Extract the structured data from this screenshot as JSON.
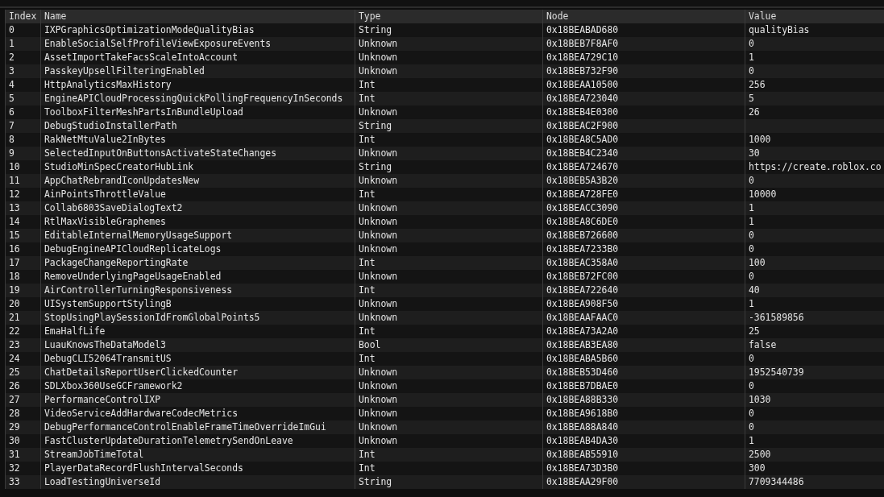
{
  "table": {
    "columns": [
      "Index",
      "Name",
      "Type",
      "Node",
      "Value"
    ],
    "rows": [
      {
        "index": "0",
        "name": "IXPGraphicsOptimizationModeQualityBias",
        "type": "String",
        "node": "0x18BEABAD680",
        "value": "qualityBias"
      },
      {
        "index": "1",
        "name": "EnableSocialSelfProfileViewExposureEvents",
        "type": "Unknown",
        "node": "0x18BEB7F8AF0",
        "value": "0"
      },
      {
        "index": "2",
        "name": "AssetImportTakeFacsScaleIntoAccount",
        "type": "Unknown",
        "node": "0x18BEA729C10",
        "value": "1"
      },
      {
        "index": "3",
        "name": "PasskeyUpsellFilteringEnabled",
        "type": "Unknown",
        "node": "0x18BEB732F90",
        "value": "0"
      },
      {
        "index": "4",
        "name": "HttpAnalyticsMaxHistory",
        "type": "Int",
        "node": "0x18BEAA10500",
        "value": "256"
      },
      {
        "index": "5",
        "name": "EngineAPICloudProcessingQuickPollingFrequencyInSeconds",
        "type": "Int",
        "node": "0x18BEA723040",
        "value": "5"
      },
      {
        "index": "6",
        "name": "ToolboxFilterMeshPartsInBundleUpload",
        "type": "Unknown",
        "node": "0x18BEB4E0300",
        "value": "26"
      },
      {
        "index": "7",
        "name": "DebugStudioInstallerPath",
        "type": "String",
        "node": "0x18BEAC2F900"
      },
      {
        "index": "8",
        "name": "RakNetMtuValue2InBytes",
        "type": "Int",
        "node": "0x18BEA8C5AD0",
        "value": "1000"
      },
      {
        "index": "9",
        "name": "SelectedInputOnButtonsActivateStateChanges",
        "type": "Unknown",
        "node": "0x18BEB4C2340",
        "value": "30"
      },
      {
        "index": "10",
        "name": "StudioMinSpecCreatorHubLink",
        "type": "String",
        "node": "0x18BEA724670",
        "value": "https://create.roblox.co"
      },
      {
        "index": "11",
        "name": "AppChatRebrandIconUpdatesNew",
        "type": "Unknown",
        "node": "0x18BEB5A3B20",
        "value": "0"
      },
      {
        "index": "12",
        "name": "AinPointsThrottleValue",
        "type": "Int",
        "node": "0x18BEA728FE0",
        "value": "10000"
      },
      {
        "index": "13",
        "name": "Collab6803SaveDialogText2",
        "type": "Unknown",
        "node": "0x18BEACC3090",
        "value": "1"
      },
      {
        "index": "14",
        "name": "RtlMaxVisibleGraphemes",
        "type": "Unknown",
        "node": "0x18BEA8C6DE0",
        "value": "1"
      },
      {
        "index": "15",
        "name": "EditableInternalMemoryUsageSupport",
        "type": "Unknown",
        "node": "0x18BEB726600",
        "value": "0"
      },
      {
        "index": "16",
        "name": "DebugEngineAPICloudReplicateLogs",
        "type": "Unknown",
        "node": "0x18BEA7233B0",
        "value": "0"
      },
      {
        "index": "17",
        "name": "PackageChangeReportingRate",
        "type": "Int",
        "node": "0x18BEAC358A0",
        "value": "100"
      },
      {
        "index": "18",
        "name": "RemoveUnderlyingPageUsageEnabled",
        "type": "Unknown",
        "node": "0x18BEB72FC00",
        "value": "0"
      },
      {
        "index": "19",
        "name": "AirControllerTurningResponsiveness",
        "type": "Int",
        "node": "0x18BEA722640",
        "value": "40"
      },
      {
        "index": "20",
        "name": "UISystemSupportStylingB",
        "type": "Unknown",
        "node": "0x18BEA908F50",
        "value": "1"
      },
      {
        "index": "21",
        "name": "StopUsingPlaySessionIdFromGlobalPoints5",
        "type": "Unknown",
        "node": "0x18BEAAFAAC0",
        "value": "-361589856"
      },
      {
        "index": "22",
        "name": "EmaHalfLife",
        "type": "Int",
        "node": "0x18BEA73A2A0",
        "value": "25"
      },
      {
        "index": "23",
        "name": "LuauKnowsTheDataModel3",
        "type": "Bool",
        "node": "0x18BEAB3EA80",
        "value": "false"
      },
      {
        "index": "24",
        "name": "DebugCLI52064TransmitUS",
        "type": "Int",
        "node": "0x18BEABA5B60",
        "value": "0"
      },
      {
        "index": "25",
        "name": "ChatDetailsReportUserClickedCounter",
        "type": "Unknown",
        "node": "0x18BEB53D460",
        "value": "1952540739"
      },
      {
        "index": "26",
        "name": "SDLXbox360UseGCFramework2",
        "type": "Unknown",
        "node": "0x18BEB7DBAE0",
        "value": "0"
      },
      {
        "index": "27",
        "name": "PerformanceControlIXP",
        "type": "Unknown",
        "node": "0x18BEA88B330",
        "value": "1030"
      },
      {
        "index": "28",
        "name": "VideoServiceAddHardwareCodecMetrics",
        "type": "Unknown",
        "node": "0x18BEA9618B0",
        "value": "0"
      },
      {
        "index": "29",
        "name": "DebugPerformanceControlEnableFrameTimeOverrideImGui",
        "type": "Unknown",
        "node": "0x18BEA88A840",
        "value": "0"
      },
      {
        "index": "30",
        "name": "FastClusterUpdateDurationTelemetrySendOnLeave",
        "type": "Unknown",
        "node": "0x18BEAB4DA30",
        "value": "1"
      },
      {
        "index": "31",
        "name": "StreamJobTimeTotal",
        "type": "Int",
        "node": "0x18BEAB55910",
        "value": "2500"
      },
      {
        "index": "32",
        "name": "PlayerDataRecordFlushIntervalSeconds",
        "type": "Int",
        "node": "0x18BEA73D3B0",
        "value": "300"
      },
      {
        "index": "33",
        "name": "LoadTestingUniverseId",
        "type": "String",
        "node": "0x18BEAA29F00",
        "value": "7709344486"
      }
    ]
  }
}
